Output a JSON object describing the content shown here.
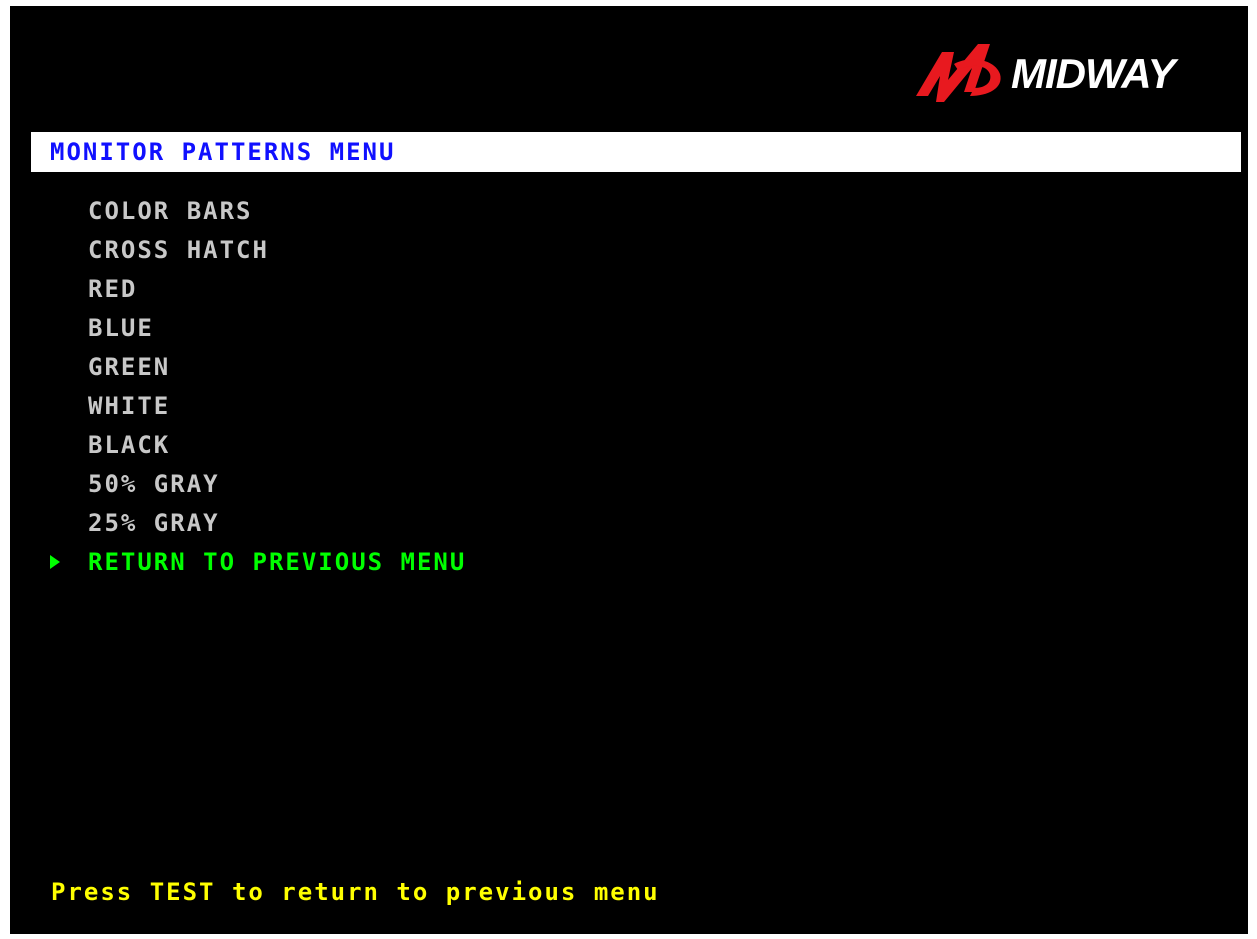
{
  "colors": {
    "background": "#000000",
    "title_bar": "#ffffff",
    "title_text": "#1010ff",
    "menu_text": "#c8c8c8",
    "selected_text": "#00ff00",
    "footer_text": "#ffff00",
    "logo_red": "#e8191f"
  },
  "logo": {
    "text": "MIDWAY",
    "icon": "midway-m-logo-icon"
  },
  "title": "MONITOR PATTERNS MENU",
  "menu": {
    "items": [
      {
        "label": "COLOR BARS",
        "selected": false
      },
      {
        "label": "CROSS HATCH",
        "selected": false
      },
      {
        "label": "RED",
        "selected": false
      },
      {
        "label": "BLUE",
        "selected": false
      },
      {
        "label": "GREEN",
        "selected": false
      },
      {
        "label": "WHITE",
        "selected": false
      },
      {
        "label": "BLACK",
        "selected": false
      },
      {
        "label": "50% GRAY",
        "selected": false
      },
      {
        "label": "25% GRAY",
        "selected": false
      },
      {
        "label": "RETURN TO PREVIOUS MENU",
        "selected": true
      }
    ],
    "cursor_icon": "triangle-right-icon"
  },
  "footer": "Press TEST to return to previous menu"
}
